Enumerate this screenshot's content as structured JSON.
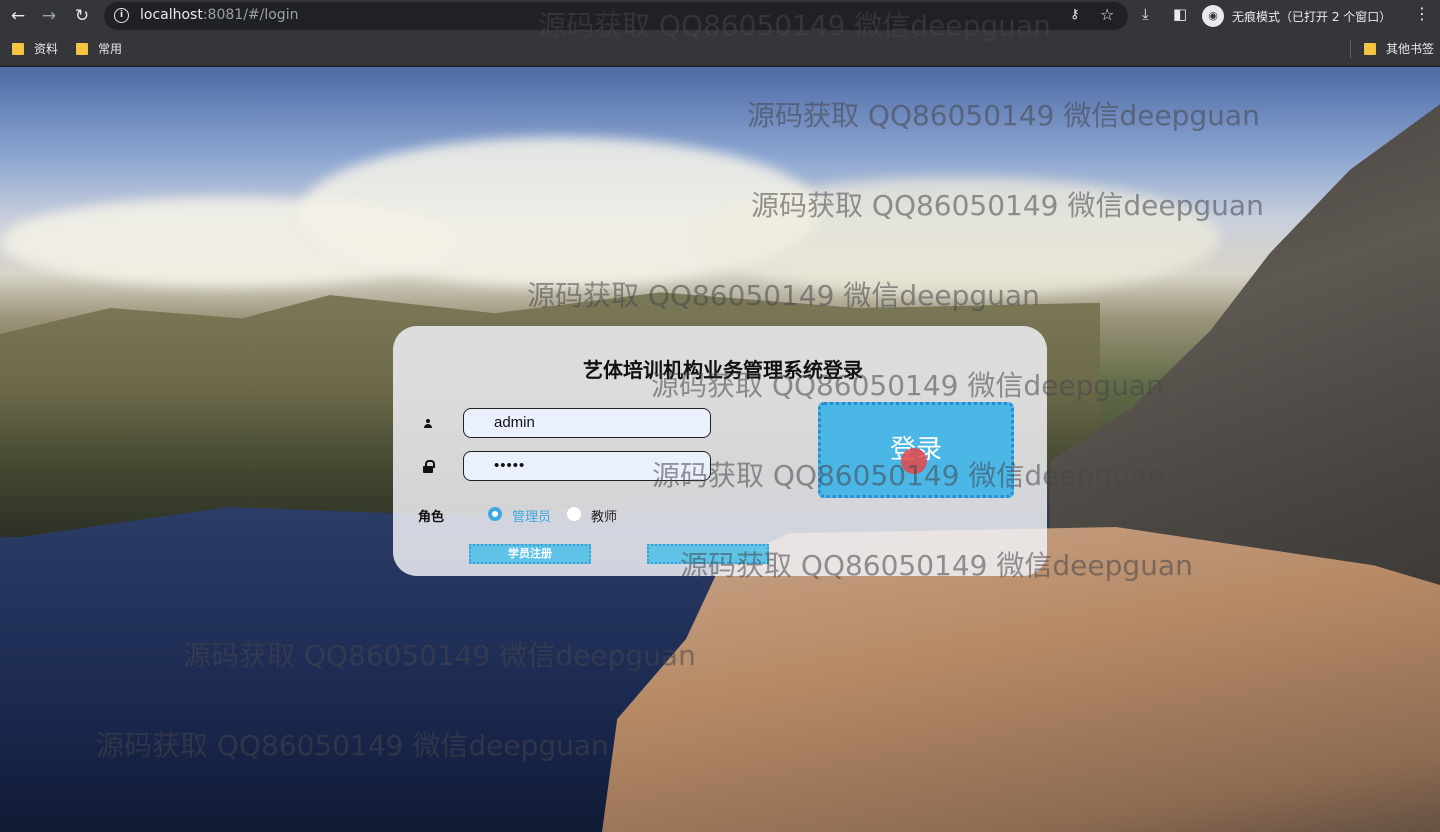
{
  "browser": {
    "url_host": "localhost",
    "url_path": ":8081/#/login",
    "incognito_text": "无痕模式（已打开 2 个窗口）",
    "bookmarks": [
      "资料",
      "常用"
    ],
    "other_bookmarks": "其他书签"
  },
  "login": {
    "title": "艺体培训机构业务管理系统登录",
    "username_value": "admin",
    "password_value": "•••••",
    "role_label": "角色",
    "roles": [
      "管理员",
      "教师"
    ],
    "selected_role": "管理员",
    "login_button": "登录",
    "register_button": "学员注册",
    "second_button": ""
  },
  "watermarks": [
    "源码获取 QQ86050149 微信deepguan",
    "源码获取 QQ86050149 微信deepguan",
    "源码获取 QQ86050149 微信deepguan",
    "源码获取 QQ86050149 微信deepguan",
    "源码获取 QQ86050149 微信deepguan",
    "源码获取 QQ86050149 微信deepguan",
    "源码获取 QQ86050149 微信deepguan",
    "源码获取 QQ86050149 微信deepguan",
    "源码获取 QQ86050149 微信deepguan"
  ],
  "colors": {
    "accent": "#3da9e0",
    "button": "#4bb7e6"
  }
}
